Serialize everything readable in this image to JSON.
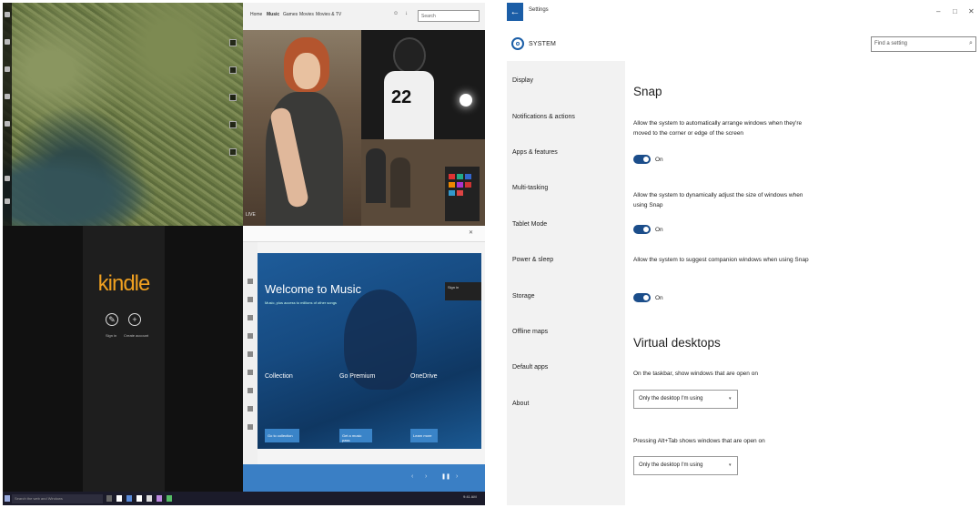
{
  "desktop": {
    "music_nav": [
      "Home",
      "Music",
      "Games",
      "Movies",
      "Movies & TV"
    ],
    "music_search_placeholder": "Search",
    "hero_label": "LIVE",
    "jersey_number": "22",
    "kindle": {
      "logo": "kindle",
      "sign_in": "Sign in",
      "create_account": "Create account"
    },
    "music_app": {
      "welcome_title": "Welcome to Music",
      "welcome_sub": "Music, plus access to millions of other songs",
      "columns": [
        "Collection",
        "Go Premium",
        "OneDrive"
      ],
      "buttons": [
        "Go to collection",
        "Get a music pass",
        "Learn more"
      ],
      "signin_badge": "Sign in"
    },
    "taskbar_search": "Search the web and Windows",
    "tray_time": "9:41 AM"
  },
  "settings": {
    "window_title": "Settings",
    "section": "SYSTEM",
    "search_placeholder": "Find a setting",
    "nav": [
      "Display",
      "Notifications & actions",
      "Apps & features",
      "Multi-tasking",
      "Tablet Mode",
      "Power & sleep",
      "Storage",
      "Offline maps",
      "Default apps",
      "About"
    ],
    "snap_heading": "Snap",
    "snap_options": [
      {
        "desc": "Allow the system to automatically arrange windows when they're moved to the corner or edge of the screen",
        "state": "On"
      },
      {
        "desc": "Allow the system to dynamically adjust the size of windows when using Snap",
        "state": "On"
      },
      {
        "desc": "Allow the system to suggest companion windows when using Snap",
        "state": "On"
      }
    ],
    "vd_heading": "Virtual desktops",
    "vd_taskbar_label": "On the taskbar, show windows that are open on",
    "vd_taskbar_value": "Only the desktop I'm using",
    "vd_alttab_label": "Pressing Alt+Tab shows windows that are open on",
    "vd_alttab_value": "Only the desktop I'm using"
  },
  "colors": {
    "accent": "#1b5ea7",
    "toggle_on": "#1b4d8a",
    "kindle_orange": "#f0a020",
    "music_blue": "#1e5c9a"
  }
}
